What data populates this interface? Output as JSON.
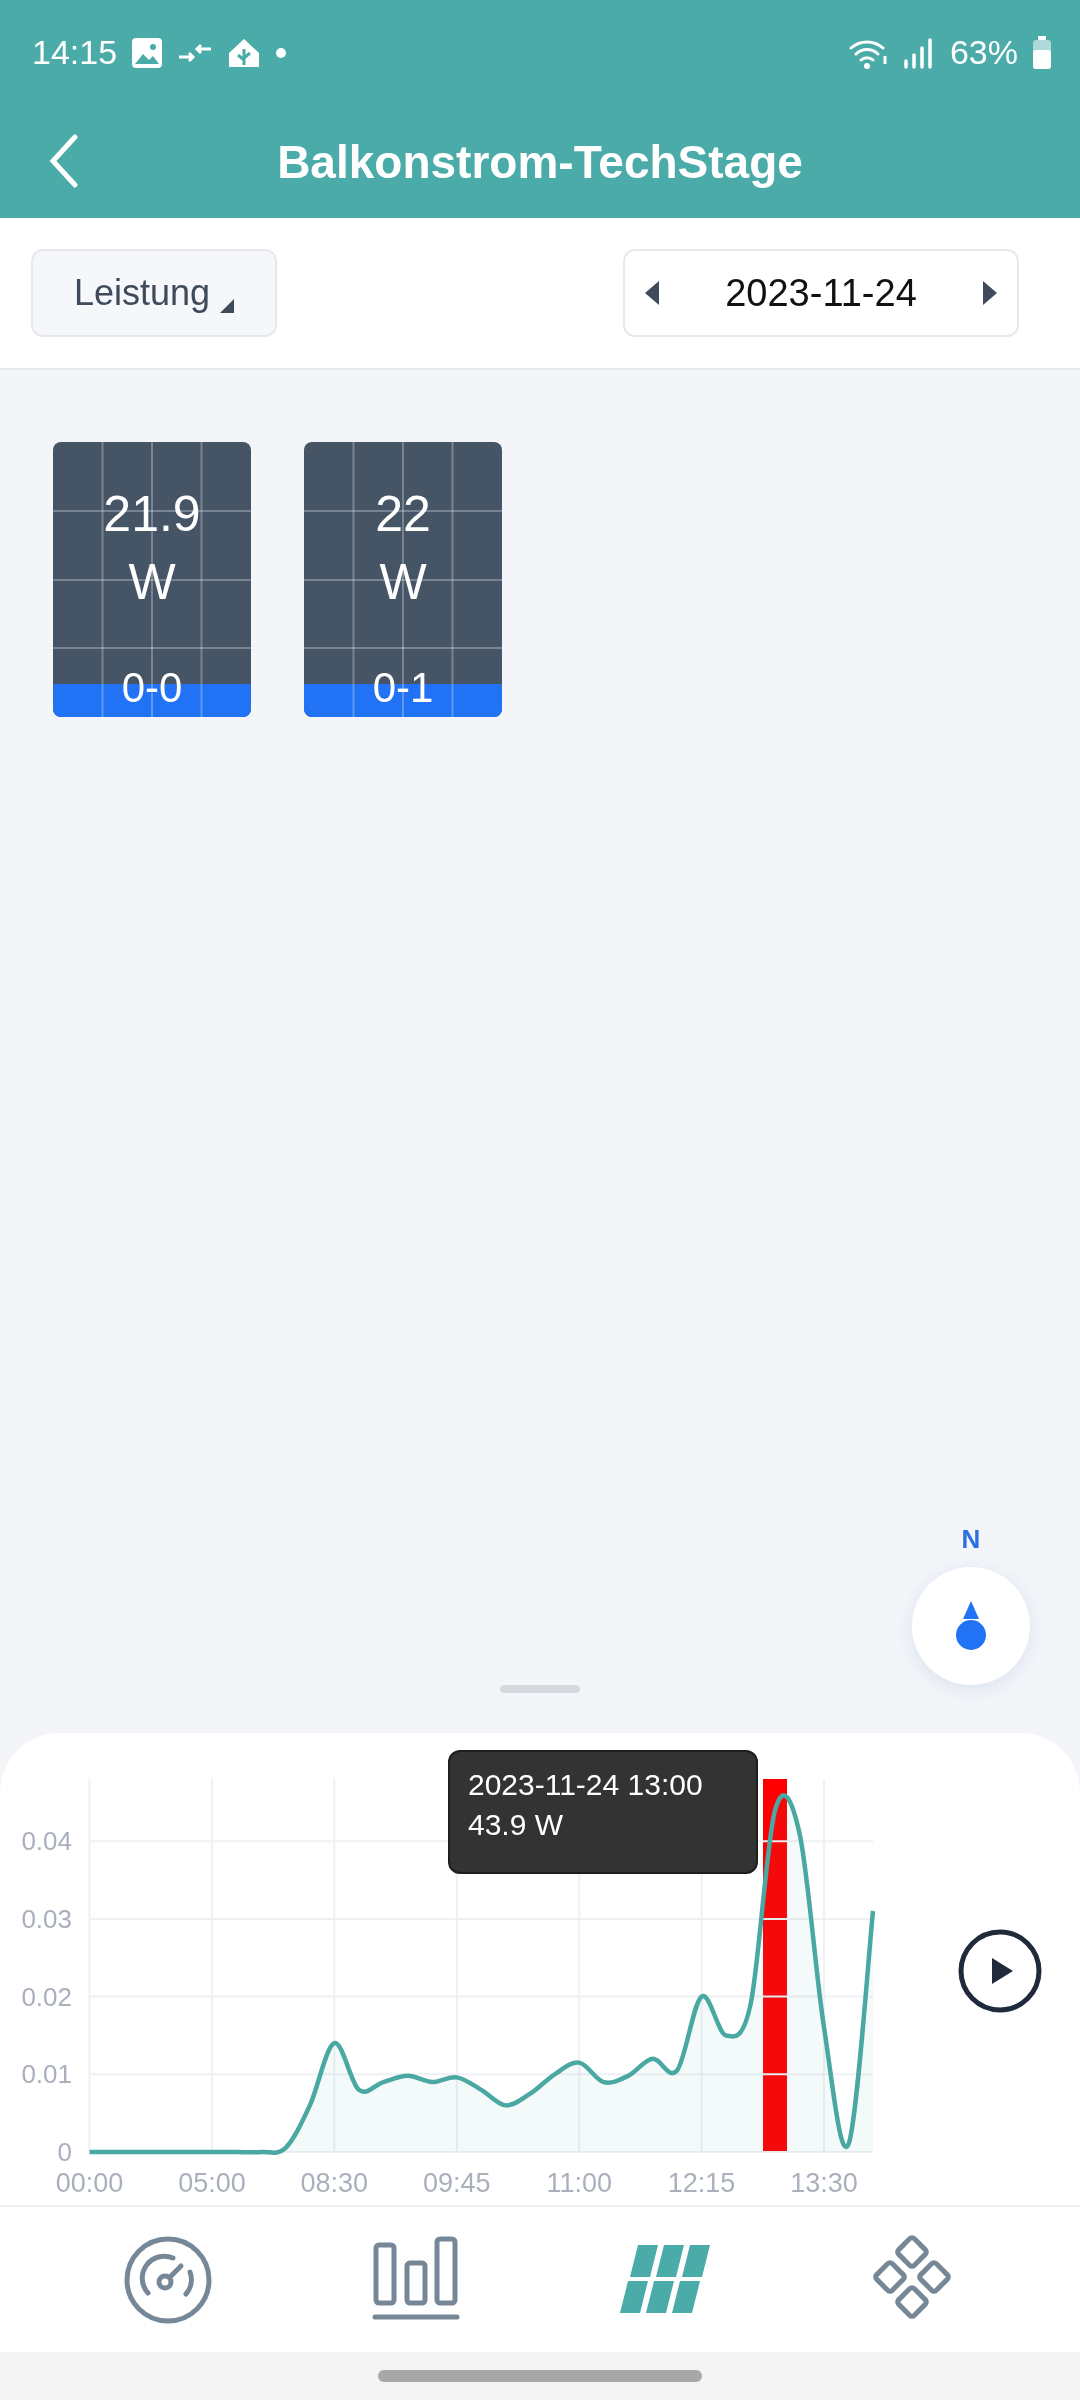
{
  "status_bar": {
    "time": "14:15",
    "battery": "63%"
  },
  "header": {
    "title": "Balkonstrom-TechStage"
  },
  "toolbar": {
    "metric": "Leistung",
    "date": "2023-11-24"
  },
  "panels": [
    {
      "value": "21.9",
      "unit": "W",
      "label": "0-0"
    },
    {
      "value": "22",
      "unit": "W",
      "label": "0-1"
    }
  ],
  "compass": {
    "label": "N"
  },
  "chart": {
    "tooltip": {
      "time": "2023-11-24 13:00",
      "value": "43.9 W"
    },
    "chart_data": {
      "type": "area",
      "grid": true,
      "series": [
        {
          "color": "#4aa8a3",
          "values": [
            0,
            0,
            0,
            0,
            0,
            0,
            0,
            0,
            0.0005,
            0.006,
            0.014,
            0.008,
            0.009,
            0.0098,
            0.009,
            0.0096,
            0.008,
            0.006,
            0.0075,
            0.01,
            0.0115,
            0.009,
            0.0098,
            0.012,
            0.0105,
            0.02,
            0.015,
            0.019,
            0.044,
            0.041,
            0.016,
            0.001,
            0.031
          ]
        }
      ],
      "ylim": [
        0,
        0.048
      ],
      "yticks": [
        {
          "value": 0,
          "label": "0"
        },
        {
          "value": 0.01,
          "label": "0.01"
        },
        {
          "value": 0.02,
          "label": "0.02"
        },
        {
          "value": 0.03,
          "label": "0.03"
        },
        {
          "value": 0.04,
          "label": "0.04"
        }
      ]
    },
    "time_labels": [
      "00:00",
      "05:00",
      "08:30",
      "09:45",
      "11:00",
      "12:15",
      "13:30"
    ]
  },
  "nav": [
    {
      "kind": "gauge",
      "selected": false
    },
    {
      "kind": "bars",
      "selected": false
    },
    {
      "kind": "panels",
      "selected": true
    },
    {
      "kind": "modules",
      "selected": false
    }
  ]
}
